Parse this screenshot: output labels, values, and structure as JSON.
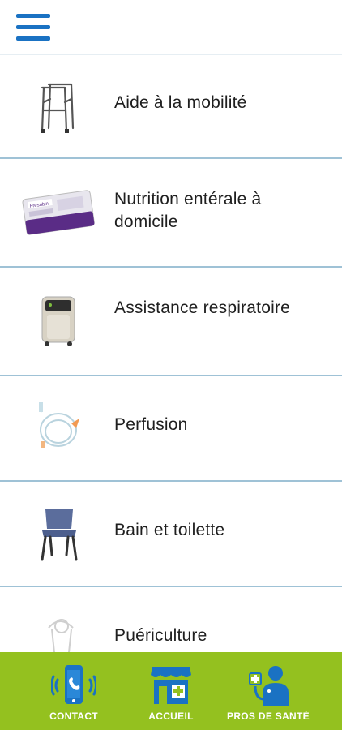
{
  "header": {
    "menu_icon": "hamburger-menu-icon"
  },
  "categories": [
    {
      "label": "Aide à la mobilité",
      "icon": "walker-icon"
    },
    {
      "label": "Nutrition entérale à domicile",
      "icon": "nutrition-pack-icon"
    },
    {
      "label": "Assistance respiratoire",
      "icon": "oxygen-concentrator-icon"
    },
    {
      "label": "Perfusion",
      "icon": "infusion-tube-icon"
    },
    {
      "label": "Bain et toilette",
      "icon": "commode-chair-icon"
    },
    {
      "label": "Puériculture",
      "icon": "breast-pump-icon"
    }
  ],
  "bottom_nav": {
    "contact": "CONTACT",
    "accueil": "ACCUEIL",
    "pros": "PROS DE SANTÉ"
  },
  "colors": {
    "primary_blue": "#1a72c3",
    "nav_green": "#94c11f",
    "divider": "#9fc2d6"
  }
}
